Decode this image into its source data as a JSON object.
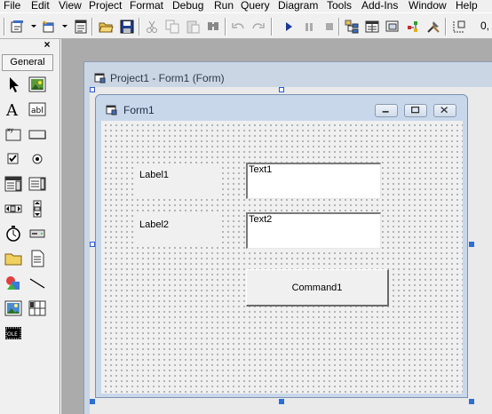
{
  "menu": {
    "items": [
      {
        "label": "File"
      },
      {
        "label": "Edit"
      },
      {
        "label": "View"
      },
      {
        "label": "Project"
      },
      {
        "label": "Format"
      },
      {
        "label": "Debug"
      },
      {
        "label": "Run"
      },
      {
        "label": "Query"
      },
      {
        "label": "Diagram"
      },
      {
        "label": "Tools"
      },
      {
        "label": "Add-Ins"
      },
      {
        "label": "Window"
      },
      {
        "label": "Help"
      }
    ]
  },
  "toolbar": {
    "coordinates_text": "0,"
  },
  "toolbox": {
    "tab_label": "General",
    "close_glyph": "×",
    "tools": [
      {
        "icon": "pointer-icon"
      },
      {
        "icon": "picturebox-icon"
      },
      {
        "icon": "label-icon"
      },
      {
        "icon": "textbox-icon"
      },
      {
        "icon": "frame-icon"
      },
      {
        "icon": "commandbutton-icon"
      },
      {
        "icon": "checkbox-icon"
      },
      {
        "icon": "optionbutton-icon"
      },
      {
        "icon": "combobox-icon"
      },
      {
        "icon": "listbox-icon"
      },
      {
        "icon": "hscrollbar-icon"
      },
      {
        "icon": "vscrollbar-icon"
      },
      {
        "icon": "timer-icon"
      },
      {
        "icon": "drivelistbox-icon"
      },
      {
        "icon": "dirlistbox-icon"
      },
      {
        "icon": "filelistbox-icon"
      },
      {
        "icon": "shape-icon"
      },
      {
        "icon": "line-icon"
      },
      {
        "icon": "image-icon"
      },
      {
        "icon": "data-icon"
      },
      {
        "icon": "ole-icon"
      }
    ]
  },
  "designer": {
    "title": "Project1 - Form1 (Form)"
  },
  "form": {
    "caption": "Form1",
    "controls": {
      "label1": "Label1",
      "label2": "Label2",
      "text1": "Text1",
      "text2": "Text2",
      "command1": "Command1"
    }
  },
  "colors": {
    "workspace": "#ababab",
    "form_caption_bg": "#c8d8ea",
    "selection_handle": "#2a6fd8"
  }
}
